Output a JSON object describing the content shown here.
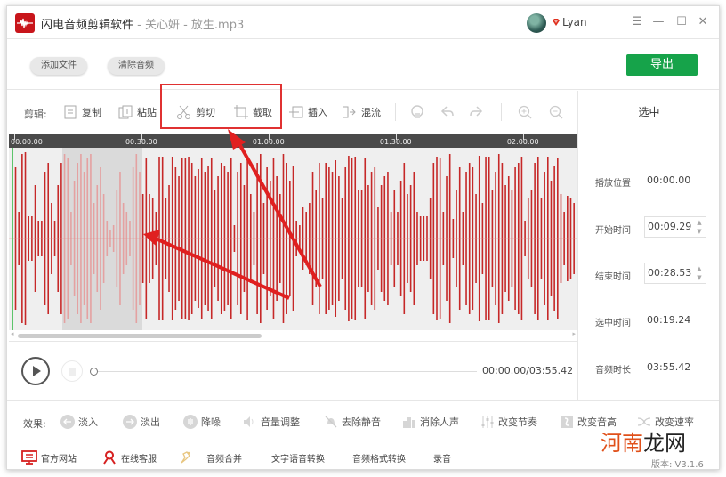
{
  "window": {
    "app_title": "闪电音频剪辑软件",
    "file_title": " - 关心妍 - 放生.mp3",
    "username": "Lyan",
    "controls": [
      "menu",
      "minimize",
      "maximize",
      "close"
    ]
  },
  "topbar": {
    "add_file": "添加文件",
    "clear_audio": "清除音频",
    "export": "导出"
  },
  "edit_toolbar": {
    "label": "剪辑:",
    "tools": [
      {
        "name": "copy",
        "label": "复制",
        "icon": "copy-icon"
      },
      {
        "name": "paste",
        "label": "粘贴",
        "icon": "paste-icon"
      },
      {
        "name": "cut",
        "label": "剪切",
        "icon": "scissors-icon"
      },
      {
        "name": "crop",
        "label": "截取",
        "icon": "crop-icon"
      },
      {
        "name": "insert",
        "label": "插入",
        "icon": "insert-icon"
      },
      {
        "name": "mix",
        "label": "混流",
        "icon": "mix-icon"
      }
    ],
    "icon_tools": [
      "loop-icon",
      "undo-icon",
      "redo-icon",
      "zoom-in-icon",
      "zoom-out-icon"
    ]
  },
  "timeline": {
    "ticks": [
      "00:00.00",
      "00:30.00",
      "01:00.00",
      "01:30.00",
      "02:00.00"
    ],
    "total_seconds": 235.42,
    "visible_seconds": 132,
    "selection_start_seconds": 9.29,
    "selection_end_seconds": 28.53,
    "playhead_seconds": 0,
    "scroll_fraction": 0.44
  },
  "waveform": {
    "color": "#c62828",
    "selected_color": "#e4a1a1",
    "amplitudes": [
      0.55,
      0.8,
      0.3,
      0.95,
      0.97,
      0.25,
      0.25,
      0.6,
      0.2,
      0.2,
      0.75,
      0.85,
      0.4,
      0.2,
      0.6,
      0.85,
      0.95,
      0.9,
      0.3,
      0.65,
      0.85,
      0.95,
      0.75,
      0.9,
      0.95,
      0.4,
      0.6,
      0.8,
      0.5,
      0.2,
      0.1,
      0.15,
      0.55,
      0.75,
      0.4,
      0.3,
      0.2,
      0.8,
      0.95,
      0.75,
      0.5,
      0.9,
      0.5,
      0.45,
      0.3,
      0.92,
      0.92,
      0.45,
      0.6,
      0.92,
      0.8,
      0.7,
      0.9,
      0.9,
      0.92,
      0.85,
      0.7,
      0.78,
      0.9,
      0.75,
      0.82,
      0.9,
      0.55,
      0.7,
      0.85,
      0.82,
      0.75,
      0.9,
      0.15,
      0.75,
      0.85,
      0.6,
      0.92,
      0.5,
      0.3,
      0.85,
      0.95,
      0.4,
      0.8,
      0.65,
      0.9,
      0.7,
      0.5,
      0.95,
      0.85,
      0.65,
      0.82,
      0.2,
      0.15,
      0.35,
      0.3,
      0.4,
      0.75,
      0.55,
      0.85,
      0.45,
      0.85,
      0.8,
      0.75,
      0.88,
      0.7,
      0.45,
      0.8,
      0.93,
      0.9,
      0.92,
      0.55,
      0.55,
      0.9,
      0.6,
      0.75,
      0.8,
      0.35,
      0.6,
      0.7,
      0.75,
      0.3,
      0.55,
      0.3,
      0.65,
      0.85,
      0.5,
      0.6,
      0.75,
      0.3,
      0.25,
      0.25,
      0.25,
      0.45,
      0.85,
      0.92,
      0.9,
      0.3,
      0.7,
      0.95,
      0.22,
      0.55,
      0.8,
      0.3,
      0.75,
      0.85,
      0.8,
      0.5,
      0.93,
      0.4,
      0.92,
      0.92,
      0.55,
      0.75,
      0.95,
      0.85,
      0.6,
      0.7,
      0.55,
      0.8,
      0.85,
      0.92,
      0.2,
      0.45,
      0.55,
      0.85,
      0.92,
      0.45,
      0.75,
      0.92,
      0.65,
      0.82,
      0.9,
      0.5,
      0.3,
      0.48,
      0.45,
      0.4
    ],
    "selection_range": [
      0,
      0
    ]
  },
  "right_panel": {
    "title": "选中",
    "play_position_label": "播放位置",
    "play_position": "00:00.00",
    "start_time_label": "开始时间",
    "start_time": "00:09.29",
    "end_time_label": "结束时间",
    "end_time": "00:28.53",
    "selected_duration_label": "选中时间",
    "selected_duration": "00:19.24",
    "audio_duration_label": "音频时长",
    "audio_duration": "03:55.42"
  },
  "player": {
    "time_readout": "00:00.00/03:55.42",
    "progress_fraction": 0
  },
  "effects": {
    "label": "效果:",
    "items": [
      {
        "label": "淡入",
        "icon": "fade-in-icon"
      },
      {
        "label": "淡出",
        "icon": "fade-out-icon"
      },
      {
        "label": "降噪",
        "icon": "noise-reduction-icon"
      },
      {
        "label": "音量调整",
        "icon": "volume-icon"
      },
      {
        "label": "去除静音",
        "icon": "mute-icon"
      },
      {
        "label": "消除人声",
        "icon": "vocal-remove-icon"
      },
      {
        "label": "改变节奏",
        "icon": "tempo-icon"
      },
      {
        "label": "改变音高",
        "icon": "pitch-icon"
      },
      {
        "label": "改变速率",
        "icon": "speed-icon"
      }
    ]
  },
  "footer": {
    "links": [
      {
        "label": "官方网站",
        "icon": "monitor-icon"
      },
      {
        "label": "在线客服",
        "icon": "user-icon"
      },
      {
        "label": "音频合并",
        "icon": "merge-icon"
      },
      {
        "label": "文字语音转换",
        "icon": ""
      },
      {
        "label": "音频格式转换",
        "icon": ""
      },
      {
        "label": "录音",
        "icon": ""
      }
    ],
    "version": "版本: V3.1.6"
  },
  "watermark": {
    "part1": "河南",
    "part2": "龙网"
  },
  "colors": {
    "brand_red": "#c8151b",
    "export_green": "#16a34a",
    "annotation_red": "#e03131",
    "playhead_green": "#5cc46a"
  }
}
